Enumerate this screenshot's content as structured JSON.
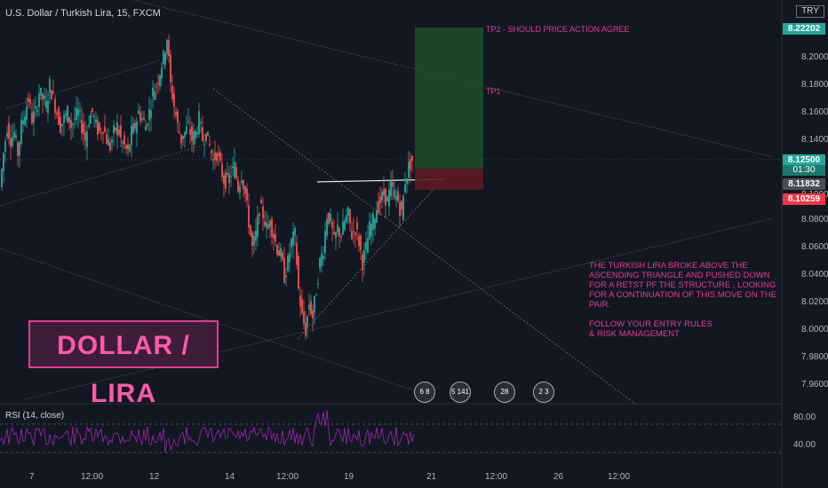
{
  "chart": {
    "title": "U.S. Dollar / Turkish Lira, 15, FXCM",
    "currency": "TRY"
  },
  "price_axis": {
    "labels": [
      "8.20000",
      "8.18000",
      "8.16000",
      "8.14000",
      "8.12000",
      "8.10000",
      "8.08000",
      "8.06000",
      "8.04000",
      "8.02000",
      "8.00000",
      "7.98000",
      "7.96000"
    ]
  },
  "price_tags": {
    "tp2": {
      "value": "8.22202",
      "color": "#26a69a"
    },
    "current": {
      "value": "8.12500",
      "color": "#26a69a"
    },
    "countdown": "01:30",
    "entry": {
      "value": "8.11832",
      "color": "#4a4e59"
    },
    "stop": {
      "value": "8.10259",
      "color": "#f23645"
    }
  },
  "date_axis": {
    "labels": [
      "7",
      "12:00",
      "12",
      "14",
      "12:00",
      "19",
      "21",
      "12:00",
      "26",
      "12:00"
    ]
  },
  "annotations": {
    "tp2": "TP2 - SHOULD PRICE ACTION AGREE",
    "tp1": "TP1",
    "note": "THE TURKISH LIRA BROKE ABOVE THE ASCENDING TRIANGLE AND PUSHED DOWN FOR A RETST PF THE STRUCTURE , LOOKING FOR A CONTINUATION OF THIS MOVE ON THE PAIR.\n\nFOLLOW YOUR ENTRY RULES\n& RISK MANAGEMENT",
    "big_label": "DOLLAR / LIRA"
  },
  "events": [
    {
      "label": "6 8"
    },
    {
      "label": "5 141"
    },
    {
      "label": "28"
    },
    {
      "label": "2 3"
    }
  ],
  "rsi": {
    "title": "RSI (14, close)",
    "levels": [
      "80.00",
      "40.00"
    ],
    "line_color": "#9c27b0"
  },
  "colors": {
    "background": "#131722",
    "up": "#26a69a",
    "down": "#ef5350",
    "annotation": "#e03e8c",
    "profit_zone": "#1e4d2b",
    "loss_zone": "#5c1a22"
  },
  "chart_data": {
    "type": "candlestick",
    "title": "U.S. Dollar / Turkish Lira, 15, FXCM",
    "ylim": [
      7.95,
      8.24
    ],
    "close_path": [
      [
        0,
        8.105
      ],
      [
        4,
        8.13
      ],
      [
        8,
        8.15
      ],
      [
        12,
        8.14
      ],
      [
        16,
        8.145
      ],
      [
        20,
        8.13
      ],
      [
        24,
        8.15
      ],
      [
        28,
        8.16
      ],
      [
        32,
        8.17
      ],
      [
        36,
        8.155
      ],
      [
        40,
        8.16
      ],
      [
        44,
        8.175
      ],
      [
        48,
        8.17
      ],
      [
        52,
        8.165
      ],
      [
        56,
        8.18
      ],
      [
        60,
        8.17
      ],
      [
        64,
        8.16
      ],
      [
        68,
        8.15
      ],
      [
        72,
        8.155
      ],
      [
        76,
        8.16
      ],
      [
        80,
        8.15
      ],
      [
        84,
        8.155
      ],
      [
        88,
        8.16
      ],
      [
        92,
        8.15
      ],
      [
        96,
        8.14
      ],
      [
        100,
        8.155
      ],
      [
        104,
        8.16
      ],
      [
        108,
        8.15
      ],
      [
        112,
        8.145
      ],
      [
        116,
        8.15
      ],
      [
        120,
        8.14
      ],
      [
        124,
        8.135
      ],
      [
        128,
        8.145
      ],
      [
        132,
        8.15
      ],
      [
        136,
        8.14
      ],
      [
        140,
        8.135
      ],
      [
        144,
        8.13
      ],
      [
        148,
        8.145
      ],
      [
        152,
        8.15
      ],
      [
        156,
        8.16
      ],
      [
        160,
        8.155
      ],
      [
        164,
        8.15
      ],
      [
        168,
        8.16
      ],
      [
        172,
        8.175
      ],
      [
        176,
        8.18
      ],
      [
        180,
        8.19
      ],
      [
        184,
        8.2
      ],
      [
        188,
        8.215
      ],
      [
        192,
        8.18
      ],
      [
        196,
        8.165
      ],
      [
        200,
        8.15
      ],
      [
        204,
        8.14
      ],
      [
        208,
        8.145
      ],
      [
        212,
        8.15
      ],
      [
        216,
        8.14
      ],
      [
        220,
        8.145
      ],
      [
        224,
        8.155
      ],
      [
        228,
        8.14
      ],
      [
        232,
        8.145
      ],
      [
        236,
        8.135
      ],
      [
        240,
        8.125
      ],
      [
        244,
        8.13
      ],
      [
        248,
        8.12
      ],
      [
        252,
        8.11
      ],
      [
        256,
        8.11
      ],
      [
        260,
        8.115
      ],
      [
        264,
        8.12
      ],
      [
        268,
        8.105
      ],
      [
        272,
        8.115
      ],
      [
        276,
        8.1
      ],
      [
        280,
        8.08
      ],
      [
        284,
        8.06
      ],
      [
        288,
        8.07
      ],
      [
        292,
        8.09
      ],
      [
        296,
        8.085
      ],
      [
        300,
        8.075
      ],
      [
        304,
        8.08
      ],
      [
        308,
        8.07
      ],
      [
        312,
        8.06
      ],
      [
        316,
        8.055
      ],
      [
        320,
        8.04
      ],
      [
        324,
        8.05
      ],
      [
        328,
        8.065
      ],
      [
        332,
        8.07
      ],
      [
        336,
        8.03
      ],
      [
        340,
        8.01
      ],
      [
        344,
        8.0
      ],
      [
        348,
        8.02
      ],
      [
        352,
        8.01
      ],
      [
        356,
        8.03
      ],
      [
        360,
        8.05
      ],
      [
        364,
        8.06
      ],
      [
        368,
        8.085
      ],
      [
        372,
        8.08
      ],
      [
        376,
        8.065
      ],
      [
        380,
        8.075
      ],
      [
        384,
        8.07
      ],
      [
        388,
        8.08
      ],
      [
        392,
        8.085
      ],
      [
        396,
        8.07
      ],
      [
        400,
        8.075
      ],
      [
        404,
        8.065
      ],
      [
        408,
        8.05
      ],
      [
        412,
        8.06
      ],
      [
        416,
        8.075
      ],
      [
        420,
        8.08
      ],
      [
        424,
        8.09
      ],
      [
        428,
        8.095
      ],
      [
        432,
        8.1
      ],
      [
        436,
        8.095
      ],
      [
        440,
        8.105
      ],
      [
        444,
        8.1
      ],
      [
        448,
        8.095
      ],
      [
        452,
        8.085
      ],
      [
        456,
        8.11
      ],
      [
        460,
        8.12
      ],
      [
        464,
        8.125
      ]
    ]
  }
}
